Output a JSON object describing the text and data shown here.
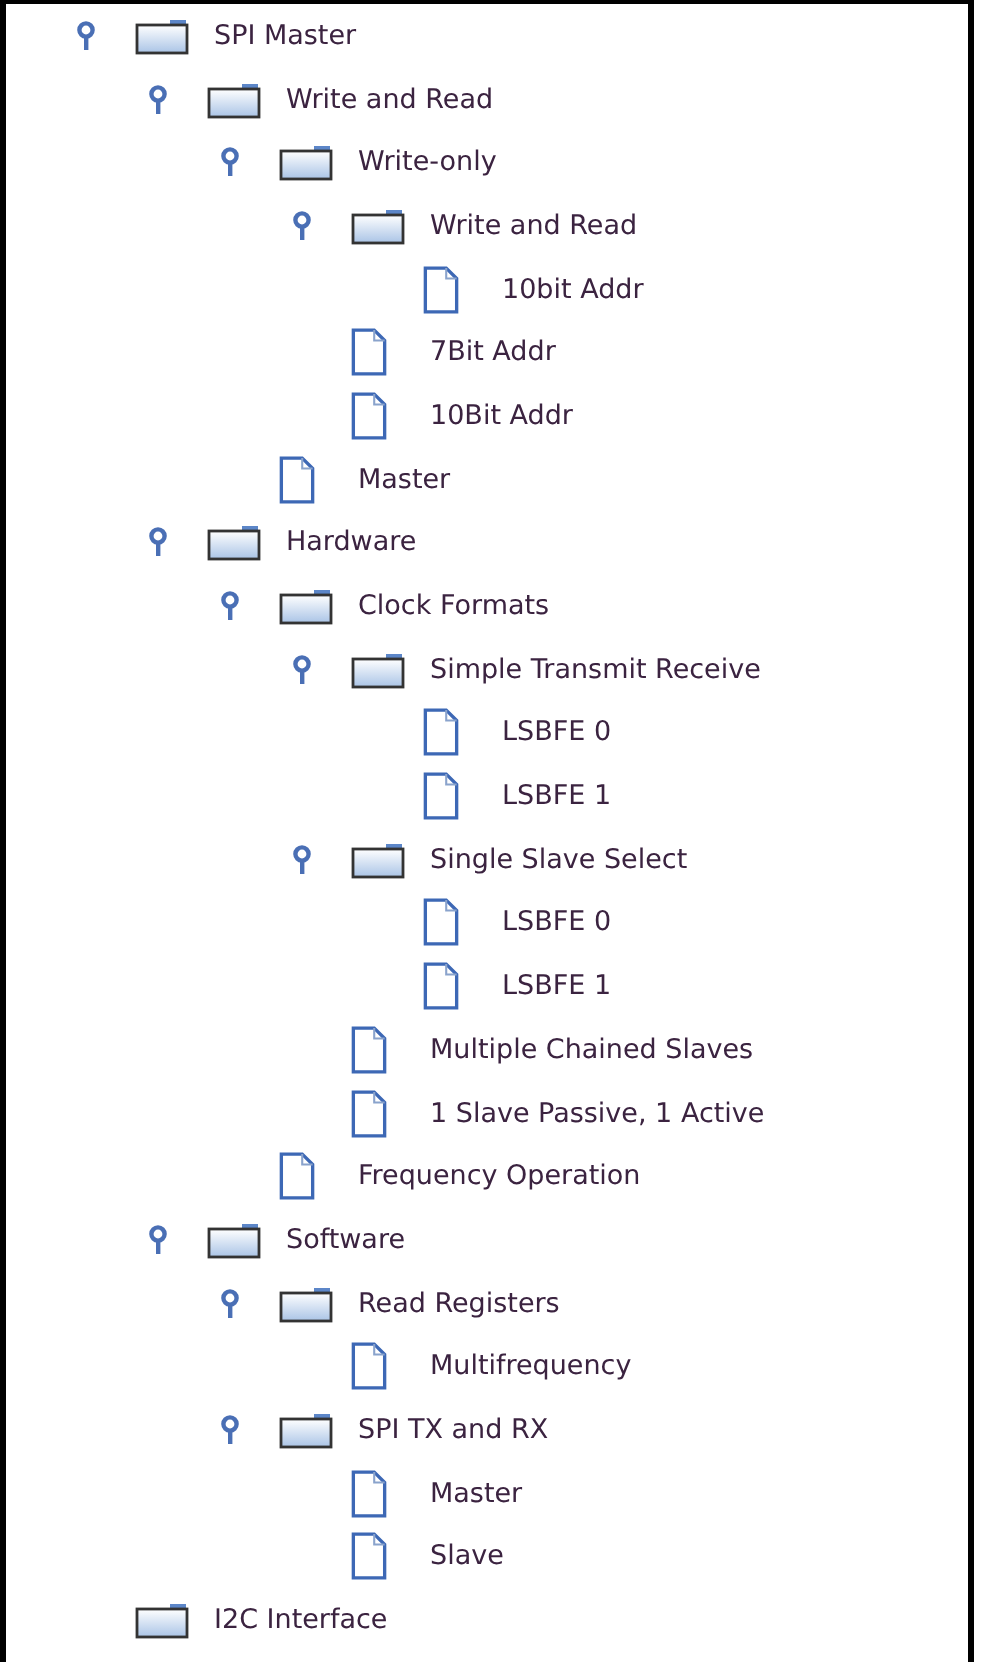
{
  "tree": [
    {
      "kind": "folder",
      "label": "SPI Master",
      "expanded": true,
      "children": [
        {
          "kind": "folder",
          "label": "Write and Read",
          "expanded": true,
          "children": [
            {
              "kind": "folder",
              "label": "Write-only",
              "expanded": true,
              "children": [
                {
                  "kind": "folder",
                  "label": "Write and Read",
                  "expanded": true,
                  "children": [
                    {
                      "kind": "file",
                      "label": "10bit Addr"
                    }
                  ]
                },
                {
                  "kind": "file",
                  "label": "7Bit Addr"
                },
                {
                  "kind": "file",
                  "label": "10Bit Addr"
                }
              ]
            },
            {
              "kind": "file",
              "label": "Master"
            }
          ]
        },
        {
          "kind": "folder",
          "label": "Hardware",
          "expanded": true,
          "children": [
            {
              "kind": "folder",
              "label": "Clock Formats",
              "expanded": true,
              "children": [
                {
                  "kind": "folder",
                  "label": "Simple Transmit Receive",
                  "expanded": true,
                  "children": [
                    {
                      "kind": "file",
                      "label": "LSBFE 0"
                    },
                    {
                      "kind": "file",
                      "label": "LSBFE 1"
                    }
                  ]
                },
                {
                  "kind": "folder",
                  "label": "Single Slave Select",
                  "expanded": true,
                  "children": [
                    {
                      "kind": "file",
                      "label": "LSBFE 0"
                    },
                    {
                      "kind": "file",
                      "label": "LSBFE 1"
                    }
                  ]
                },
                {
                  "kind": "file",
                  "label": "Multiple Chained Slaves"
                },
                {
                  "kind": "file",
                  "label": "1 Slave Passive, 1 Active"
                }
              ]
            },
            {
              "kind": "file",
              "label": "Frequency Operation"
            }
          ]
        },
        {
          "kind": "folder",
          "label": "Software",
          "expanded": true,
          "children": [
            {
              "kind": "folder",
              "label": "Read Registers",
              "expanded": true,
              "children": [
                {
                  "kind": "file",
                  "label": "Multifrequency"
                }
              ]
            },
            {
              "kind": "folder",
              "label": "SPI TX and RX",
              "expanded": true,
              "children": [
                {
                  "kind": "file",
                  "label": "Master"
                },
                {
                  "kind": "file",
                  "label": "Slave"
                }
              ]
            }
          ]
        }
      ]
    },
    {
      "kind": "folder",
      "label": "I2C Interface",
      "expanded": false
    }
  ]
}
